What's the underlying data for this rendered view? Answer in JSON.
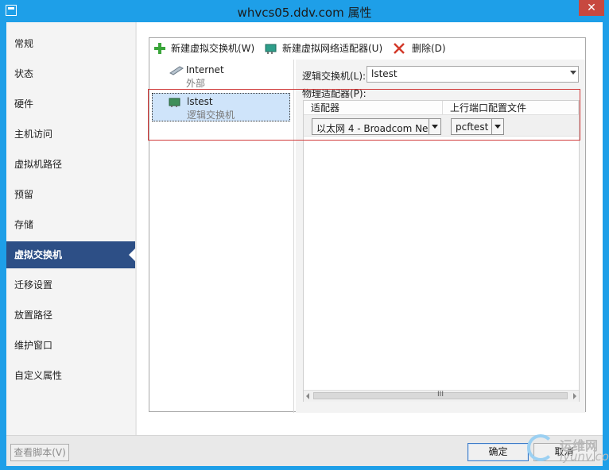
{
  "window": {
    "title": "whvcs05.ddv.com 属性",
    "close_glyph": "✕"
  },
  "nav": {
    "items": [
      "常规",
      "状态",
      "硬件",
      "主机访问",
      "虚拟机路径",
      "预留",
      "存储",
      "虚拟交换机",
      "迁移设置",
      "放置路径",
      "维护窗口",
      "自定义属性"
    ],
    "active": "虚拟交换机"
  },
  "toolbar": {
    "new_switch": "新建虚拟交换机(W)",
    "new_adapter": "新建虚拟网络适配器(U)",
    "delete": "删除(D)"
  },
  "switches": [
    {
      "name": "Internet",
      "type": "外部"
    },
    {
      "name": "lstest",
      "type": "逻辑交换机"
    }
  ],
  "detail": {
    "logical_switch_label": "逻辑交换机(L):",
    "logical_switch_value": "lstest",
    "physical_adapters_label": "物理适配器(P):",
    "columns": [
      "适配器",
      "上行端口配置文件"
    ],
    "row": {
      "adapter": "以太网 4 - Broadcom Ne",
      "profile": "pcftest"
    },
    "scroll_grip": "III"
  },
  "footer": {
    "view_script": "查看脚本(V)",
    "ok": "确定",
    "cancel": "取消"
  },
  "watermark": {
    "line1": "运维网",
    "line2": "iyunv.com"
  },
  "colors": {
    "titlebar": "#1e9fe8",
    "nav_active": "#2d4f86",
    "selection": "#cfe4fa",
    "highlight_box": "#d03a3a"
  }
}
